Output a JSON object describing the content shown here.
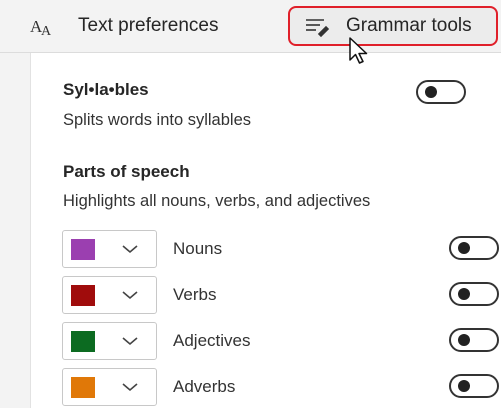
{
  "tabs": [
    {
      "label": "Text preferences",
      "icon": "text-size-icon",
      "selected": false
    },
    {
      "label": "Grammar tools",
      "icon": "grammar-tools-icon",
      "selected": true
    }
  ],
  "syllables": {
    "title": "Syl•la•bles",
    "description": "Splits words into syllables",
    "enabled": false
  },
  "parts_of_speech": {
    "title": "Parts of speech",
    "description": "Highlights all nouns, verbs, and adjectives",
    "items": [
      {
        "label": "Nouns",
        "color": "#9b3fb0",
        "enabled": false
      },
      {
        "label": "Verbs",
        "color": "#a00c0c",
        "enabled": false
      },
      {
        "label": "Adjectives",
        "color": "#0c6b21",
        "enabled": false
      },
      {
        "label": "Adverbs",
        "color": "#e07808",
        "enabled": false
      }
    ]
  },
  "colors": {
    "highlight_border": "#e0202a",
    "toggle_off": "#222222"
  }
}
